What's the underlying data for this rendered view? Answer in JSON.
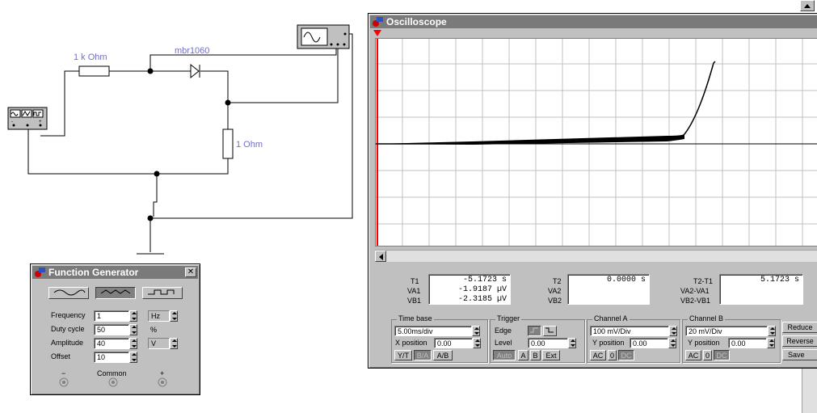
{
  "circuit": {
    "r1_label": "1 k Ohm",
    "diode_label": "mbr1060",
    "r2_label": "1  Ohm"
  },
  "function_generator": {
    "title": "Function Generator",
    "close_glyph": "✕",
    "frequency_label": "Frequency",
    "frequency_value": "1",
    "frequency_unit": "Hz",
    "duty_label": "Duty cycle",
    "duty_value": "50",
    "duty_unit": "%",
    "amplitude_label": "Amplitude",
    "amplitude_value": "40",
    "amplitude_unit": "V",
    "offset_label": "Offset",
    "offset_value": "10",
    "minus_label": "−",
    "common_label": "Common",
    "plus_label": "+"
  },
  "oscilloscope": {
    "title": "Oscilloscope",
    "trace_color": "#000000",
    "cursor_color": "#ff0000",
    "grid_color": "#c0c0c0",
    "t1_label": "T1",
    "va1_label": "VA1",
    "vb1_label": "VB1",
    "t1_value": "-5.1723  s",
    "va1_value": "-1.9187 µV",
    "vb1_value": "-2.3185 µV",
    "t2_label": "T2",
    "va2_label": "VA2",
    "vb2_label": "VB2",
    "t2_value": "0.0000  s",
    "dt_label": "T2-T1",
    "dva_label": "VA2-VA1",
    "dvb_label": "VB2-VB1",
    "dt_value": "5.1723  s",
    "timebase_label": "Time base",
    "timebase_value": "5.00ms/div",
    "xpos_label": "X position",
    "xpos_value": "0.00",
    "yt_label": "Y/T",
    "ba_label": "B/A",
    "ab_label": "A/B",
    "trigger_label": "Trigger",
    "edge_label": "Edge",
    "level_label": "Level",
    "level_value": "0.00",
    "auto_label": "Auto",
    "a_label": "A",
    "b_label": "B",
    "ext_label": "Ext",
    "channel_a_label": "Channel A",
    "channel_a_value": "100 mV/Div",
    "ya_label": "Y position",
    "ya_value": "0.00",
    "channel_b_label": "Channel B",
    "channel_b_value": "20 mV/Div",
    "yb_label": "Y position",
    "yb_value": "0.00",
    "ac_label": "AC",
    "zero_label": "0",
    "dc_label": "DC",
    "reduce_label": "Reduce",
    "reverse_label": "Reverse",
    "save_label": "Save"
  }
}
